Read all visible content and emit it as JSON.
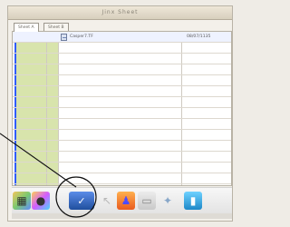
{
  "window": {
    "title": "Jinx Sheet"
  },
  "tabs": [
    {
      "label": "Sheet A"
    },
    {
      "label": "Sheet B"
    }
  ],
  "sheet": {
    "rows": [
      {
        "name": "Casper7.TF",
        "date": "08/07/1135",
        "selected": true
      },
      {
        "name": "",
        "date": ""
      },
      {
        "name": "",
        "date": ""
      },
      {
        "name": "",
        "date": ""
      },
      {
        "name": "",
        "date": ""
      },
      {
        "name": "",
        "date": ""
      },
      {
        "name": "",
        "date": ""
      },
      {
        "name": "",
        "date": ""
      },
      {
        "name": "",
        "date": ""
      },
      {
        "name": "",
        "date": ""
      },
      {
        "name": "",
        "date": ""
      },
      {
        "name": "",
        "date": ""
      },
      {
        "name": "",
        "date": ""
      }
    ]
  },
  "toolbar": {
    "items": [
      {
        "name": "apps-icon"
      },
      {
        "name": "palette-icon"
      },
      {
        "name": "document-check-icon"
      },
      {
        "name": "arrow-icon"
      },
      {
        "name": "person-icon"
      },
      {
        "name": "device-icon"
      },
      {
        "name": "sparkle-icon"
      },
      {
        "name": "bag-icon"
      }
    ]
  },
  "colors": {
    "accent_blue": "#305cff",
    "strip_green": "#d8e4ac"
  }
}
